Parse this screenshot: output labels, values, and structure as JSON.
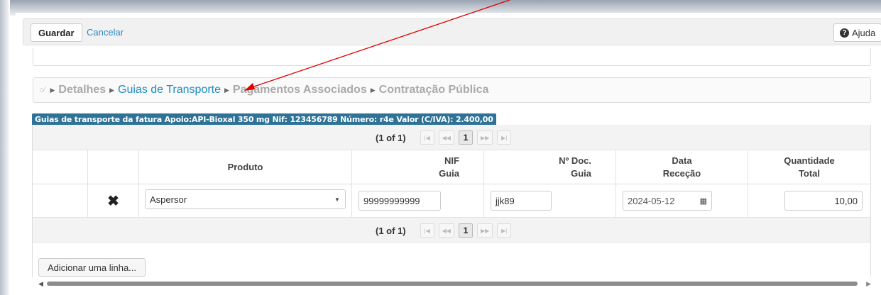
{
  "toolbar": {
    "save_label": "Guardar",
    "cancel_label": "Cancelar",
    "help_label": "Ajuda"
  },
  "breadcrumb": {
    "items": [
      {
        "label": "Detalhes",
        "state": "disabled"
      },
      {
        "label": "Guias de Transporte",
        "state": "active"
      },
      {
        "label": "Pagamentos Associados",
        "state": "disabled"
      },
      {
        "label": "Contratação Pública",
        "state": "disabled"
      }
    ]
  },
  "caption": "Guias de transporte da fatura  Apoio:API-Bioxal 350 mg  Nif: 123456789  Número: r4e  Valor (C/IVA): 2.400,00",
  "pager": {
    "count": "(1 of 1)",
    "page": "1"
  },
  "columns": {
    "produto": "Produto",
    "nif_line1": "NIF",
    "nif_line2": "Guia",
    "doc_line1": "Nº Doc.",
    "doc_line2": "Guia",
    "data_line1": "Data",
    "data_line2": "Receção",
    "qty_line1": "Quantidade",
    "qty_line2": "Total"
  },
  "row": {
    "produto": "Aspersor",
    "nif": "99999999999",
    "doc": "jjk89",
    "data": "2024-05-12",
    "quantidade": "10,00"
  },
  "add_line_label": "Adicionar uma linha...",
  "colors": {
    "caption_bg": "#2e7397",
    "link": "#1f8cc2",
    "annotation_arrow": "#e00000"
  }
}
